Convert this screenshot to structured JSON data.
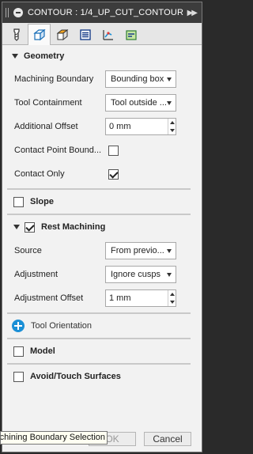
{
  "window": {
    "title": "CONTOUR : 1/4_UP_CUT_CONTOUR"
  },
  "tabs": [
    {
      "icon": "tool-icon"
    },
    {
      "icon": "geometry-icon"
    },
    {
      "icon": "heights-icon"
    },
    {
      "icon": "passes-icon"
    },
    {
      "icon": "linking-icon"
    },
    {
      "icon": "post-icon"
    }
  ],
  "geometry": {
    "header": "Geometry",
    "machining_boundary": {
      "label": "Machining Boundary",
      "value": "Bounding box"
    },
    "tool_containment": {
      "label": "Tool Containment",
      "value": "Tool outside ..."
    },
    "additional_offset": {
      "label": "Additional Offset",
      "value": "0 mm"
    },
    "contact_point_boundary": {
      "label": "Contact Point Bound...",
      "checked": false
    },
    "contact_only": {
      "label": "Contact Only",
      "checked": true
    }
  },
  "slope": {
    "label": "Slope",
    "checked": false
  },
  "rest_machining": {
    "label": "Rest Machining",
    "checked": true,
    "source": {
      "label": "Source",
      "value": "From previo..."
    },
    "adjustment": {
      "label": "Adjustment",
      "value": "Ignore cusps"
    },
    "adjustment_offset": {
      "label": "Adjustment Offset",
      "value": "1 mm"
    }
  },
  "tool_orientation": {
    "label": "Tool Orientation"
  },
  "model": {
    "label": "Model",
    "checked": false
  },
  "avoid_touch": {
    "label": "Avoid/Touch Surfaces",
    "checked": false
  },
  "footer": {
    "ok": "OK",
    "cancel": "Cancel"
  },
  "tooltip": {
    "text": "Machining Boundary Selection"
  },
  "colors": {
    "accent": "#1a8fd6",
    "titlebar": "#3c3c3c",
    "panel": "#f2f2f2"
  }
}
